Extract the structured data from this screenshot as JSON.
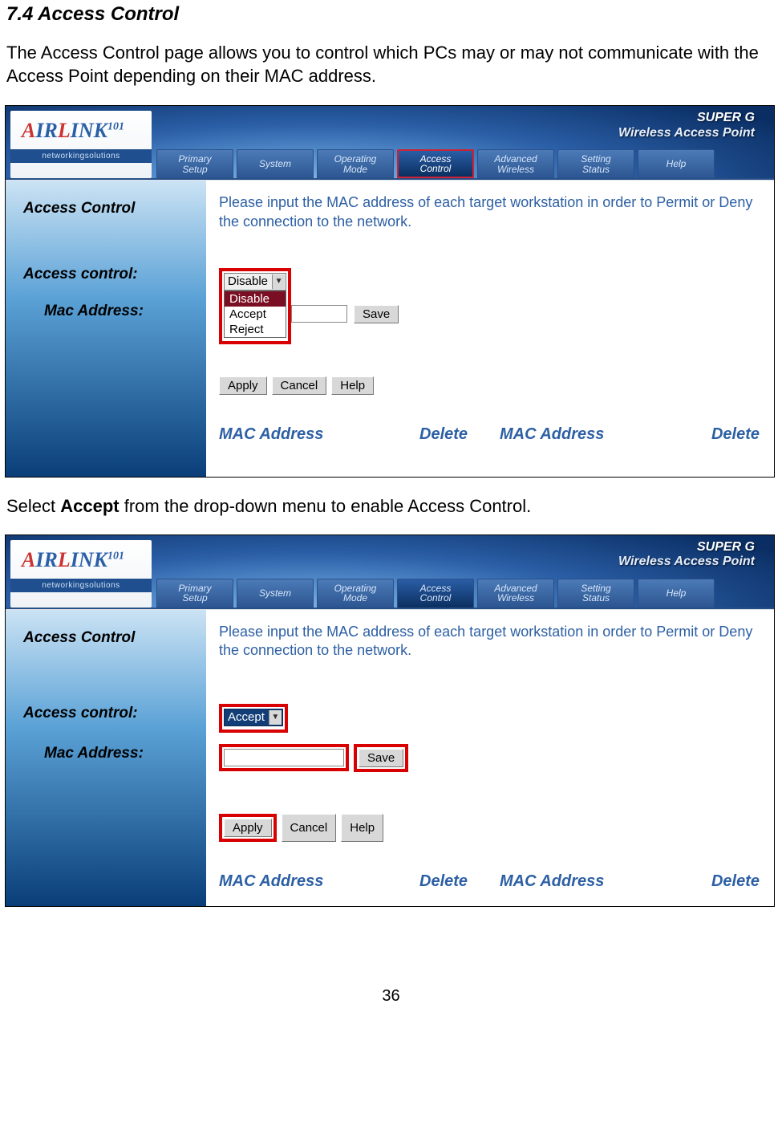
{
  "section_title": "7.4 Access Control",
  "intro_text": "The Access Control page allows you to control which PCs may or may not communicate with the Access Point depending on their MAC address.",
  "between_pre": "Select ",
  "between_bold": "Accept",
  "between_post": " from the drop-down menu to enable Access Control.",
  "page_number": "36",
  "banner": {
    "brand_line1": "SUPER G",
    "brand_line2": "Wireless Access Point",
    "logo_main": "AIRLINK",
    "logo_num": "101",
    "logo_sub": "networkingsolutions",
    "tabs": [
      {
        "line1": "Primary",
        "line2": "Setup"
      },
      {
        "line1": "System",
        "line2": ""
      },
      {
        "line1": "Operating",
        "line2": "Mode"
      },
      {
        "line1": "Access",
        "line2": "Control"
      },
      {
        "line1": "Advanced",
        "line2": "Wireless"
      },
      {
        "line1": "Setting",
        "line2": "Status"
      },
      {
        "line1": "Help",
        "line2": ""
      }
    ]
  },
  "panel": {
    "side_title": "Access Control",
    "label_access_control": "Access control:",
    "label_mac_address": "Mac Address:",
    "description": "Please input the MAC address of each target workstation in order to Permit or Deny the connection to the network.",
    "dropdown_value_disable": "Disable",
    "dropdown_options": [
      "Disable",
      "Accept",
      "Reject"
    ],
    "dropdown_value_accept": "Accept",
    "mac_value": "",
    "btn_save": "Save",
    "btn_apply": "Apply",
    "btn_cancel": "Cancel",
    "btn_help": "Help",
    "th_mac": "MAC Address",
    "th_delete": "Delete"
  }
}
